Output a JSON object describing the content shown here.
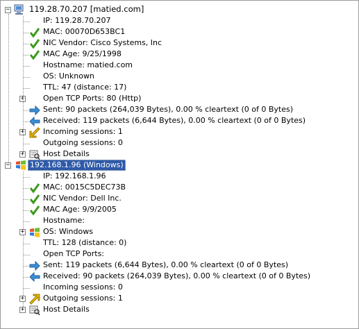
{
  "hosts": [
    {
      "title": "119.28.70.207 [matied.com]",
      "icon": "computer-icon",
      "items": [
        {
          "text": "IP: 119.28.70.207",
          "icon": "none"
        },
        {
          "text": "MAC: 00070D653BC1",
          "icon": "green-check-icon"
        },
        {
          "text": "NIC Vendor: Cisco Systems, Inc",
          "icon": "green-check-icon"
        },
        {
          "text": "MAC Age: 9/25/1998",
          "icon": "green-check-icon"
        },
        {
          "text": "Hostname: matied.com",
          "icon": "none"
        },
        {
          "text": "OS: Unknown",
          "icon": "none"
        },
        {
          "text": "TTL: 47 (distance: 17)",
          "icon": "none"
        },
        {
          "text": "Open TCP Ports: 80 (Http)",
          "icon": "none",
          "expandable": true
        },
        {
          "text": "Sent: 90 packets (264,039 Bytes), 0.00 % cleartext (0 of 0 Bytes)",
          "icon": "blue-right-arrow-icon"
        },
        {
          "text": "Received: 119 packets (6,644 Bytes), 0.00 % cleartext (0 of 0 Bytes)",
          "icon": "blue-left-arrow-icon"
        },
        {
          "text": "Incoming sessions: 1",
          "icon": "incoming-session-icon",
          "expandable": true
        },
        {
          "text": "Outgoing sessions: 0",
          "icon": "none"
        },
        {
          "text": "Host Details",
          "icon": "host-details-icon",
          "expandable": true
        }
      ]
    },
    {
      "title": "192.168.1.96 (Windows)",
      "icon": "windows-logo-icon",
      "items": [
        {
          "text": "IP: 192.168.1.96",
          "icon": "none"
        },
        {
          "text": "MAC: 0015C5DEC73B",
          "icon": "green-check-icon"
        },
        {
          "text": "NIC Vendor: Dell Inc.",
          "icon": "green-check-icon"
        },
        {
          "text": "MAC Age: 9/9/2005",
          "icon": "green-check-icon"
        },
        {
          "text": "Hostname:",
          "icon": "none"
        },
        {
          "text": "OS: Windows",
          "icon": "windows-logo-icon",
          "expandable": true
        },
        {
          "text": "TTL: 128 (distance: 0)",
          "icon": "none"
        },
        {
          "text": "Open TCP Ports:",
          "icon": "none"
        },
        {
          "text": "Sent: 119 packets (6,644 Bytes), 0.00 % cleartext (0 of 0 Bytes)",
          "icon": "blue-right-arrow-icon"
        },
        {
          "text": "Received: 90 packets (264,039 Bytes), 0.00 % cleartext (0 of 0 Bytes)",
          "icon": "blue-left-arrow-icon"
        },
        {
          "text": "Incoming sessions: 0",
          "icon": "none"
        },
        {
          "text": "Outgoing sessions: 1",
          "icon": "outgoing-session-icon",
          "expandable": true
        },
        {
          "text": "Host Details",
          "icon": "host-details-icon",
          "expandable": true
        }
      ]
    }
  ]
}
